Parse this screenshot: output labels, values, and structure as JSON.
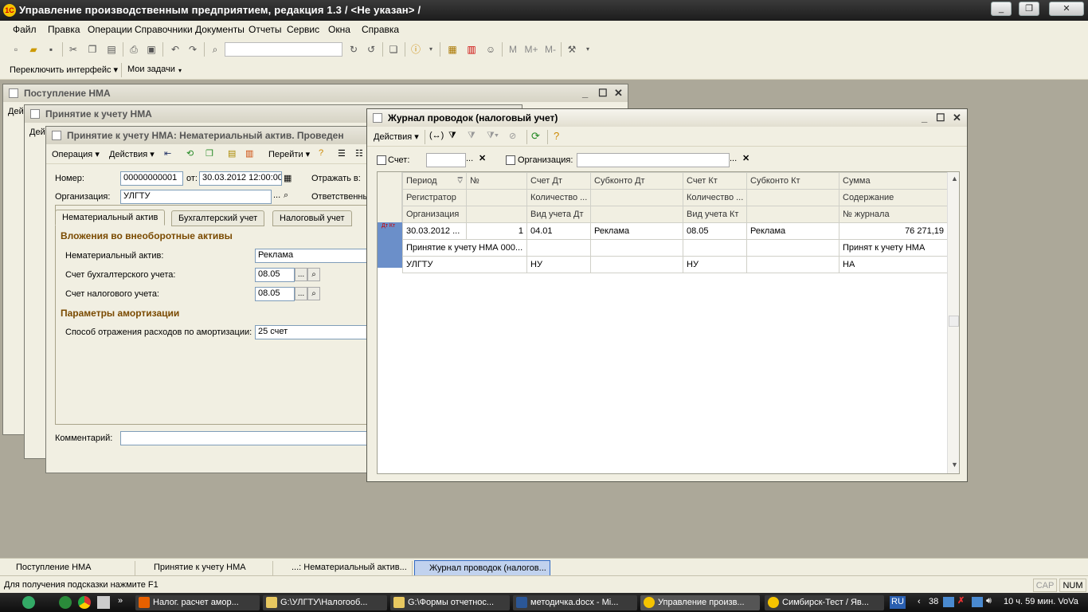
{
  "app": {
    "title": "Управление производственным предприятием, редакция 1.3 / <Не указан> /"
  },
  "menu": [
    "Файл",
    "Правка",
    "Операции",
    "Справочники",
    "Документы",
    "Отчеты",
    "Сервис",
    "Окна",
    "Справка"
  ],
  "tasks_panel": {
    "switch": "Переключить интерфейс ▾",
    "mytasks": "Мои задачи"
  },
  "win1": {
    "title": "Поступление НМА",
    "cut": "Дей"
  },
  "win2": {
    "title": "Принятие к учету НМА",
    "cut": "Дей"
  },
  "doc": {
    "title": "Принятие к учету НМА: Нематериальный актив. Проведен",
    "toolbar": {
      "operation": "Операция ▾",
      "actions": "Действия ▾",
      "goto": "Перейти ▾"
    },
    "number_label": "Номер:",
    "number": "00000000001",
    "from_label": "от:",
    "date": "30.03.2012 12:00:00",
    "reflect_label": "Отражать в:",
    "org_label": "Организация:",
    "org": "УЛГТУ",
    "resp_label": "Ответственны",
    "tabs": [
      "Нематериальный актив",
      "Бухгалтерский учет",
      "Налоговый учет"
    ],
    "sec1": "Вложения во внеоборотные активы",
    "nma_label": "Нематериальный актив:",
    "nma": "Реклама",
    "acc_b_label": "Счет бухгалтерского учета:",
    "acc_b": "08.05",
    "acc_n_label": "Счет налогового учета:",
    "acc_n": "08.05",
    "sec2": "Параметры амортизации",
    "amort_label": "Способ отражения расходов по амортизации:",
    "amort": "25 счет",
    "comment_label": "Комментарий:"
  },
  "journal": {
    "title": "Журнал проводок (налоговый учет)",
    "actions": "Действия ▾",
    "filter_acc": "Счет:",
    "filter_org": "Организация:",
    "headers": [
      [
        "Период",
        "№",
        "Счет Дт",
        "Субконто Дт",
        "Счет Кт",
        "Субконто Кт",
        "Сумма"
      ],
      [
        "Регистратор",
        "",
        "Количество ...",
        "",
        "Количество ...",
        "",
        "Содержание"
      ],
      [
        "Организация",
        "",
        "Вид учета Дт",
        "",
        "Вид учета Кт",
        "",
        "№ журнала"
      ]
    ],
    "rows": [
      [
        "30.03.2012 ...",
        "1",
        "04.01",
        "Реклама",
        "08.05",
        "Реклама",
        "76 271,19"
      ],
      [
        "Принятие к учету НМА 000...",
        "",
        "",
        "",
        "",
        "",
        "Принят к учету НМА"
      ],
      [
        "УЛГТУ",
        "",
        "НУ",
        "",
        "НУ",
        "",
        "НА"
      ]
    ],
    "row_icon": "Дт Кт"
  },
  "windows_bar": [
    "Поступление НМА",
    "Принятие к учету НМА",
    "...: Нематериальный актив...",
    "Журнал проводок (налогов..."
  ],
  "status": {
    "hint": "Для получения подсказки нажмите F1",
    "cap": "CAP",
    "num": "NUM"
  },
  "taskbar": {
    "items": [
      "Налог. расчет амор...",
      "G:\\УЛГТУ\\Налогооб...",
      "G:\\Формы отчетнос...",
      "методичка.docx - Mi...",
      "Управление произв...",
      "Симбирск-Тест / Яв..."
    ],
    "lang": "RU",
    "tray_num": "38",
    "clock": "10 ч. 59 мин. VoVa"
  }
}
